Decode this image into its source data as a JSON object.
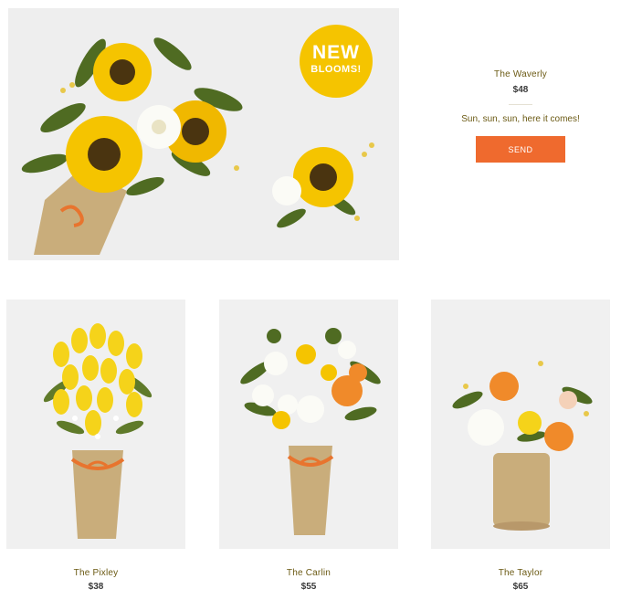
{
  "hero": {
    "badge_line1": "NEW",
    "badge_line2": "BLOOMS!",
    "name": "The Waverly",
    "price": "$48",
    "tagline": "Sun, sun, sun, here it comes!",
    "button_label": "SEND"
  },
  "products": [
    {
      "name": "The Pixley",
      "price": "$38"
    },
    {
      "name": "The Carlin",
      "price": "$55"
    },
    {
      "name": "The Taylor",
      "price": "$65"
    }
  ],
  "colors": {
    "accent": "#ef6a2e",
    "badge": "#f5c400",
    "name_text": "#6b5a14",
    "price_text": "#3a3a3a"
  }
}
